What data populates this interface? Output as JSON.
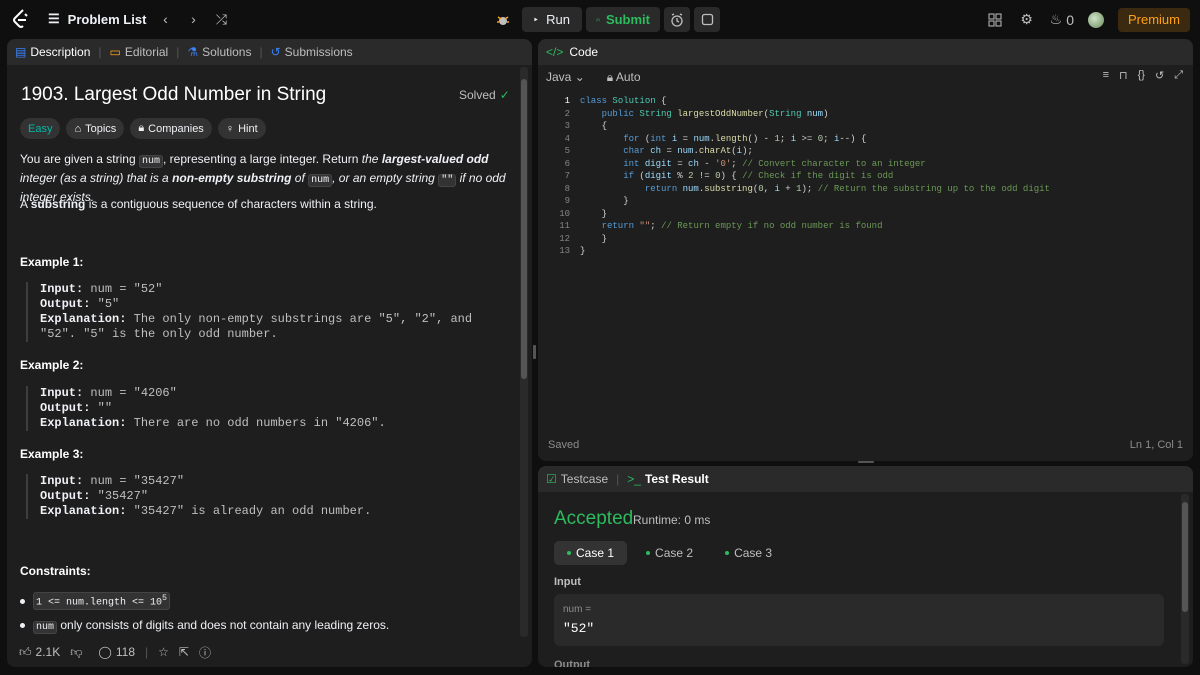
{
  "topbar": {
    "problem_list": "Problem List",
    "run": "Run",
    "submit": "Submit",
    "streak": "0",
    "premium": "Premium"
  },
  "left_tabs": [
    "Description",
    "Editorial",
    "Solutions",
    "Submissions"
  ],
  "problem": {
    "title": "1903. Largest Odd Number in String",
    "solved": "Solved",
    "chips": [
      "Easy",
      "Topics",
      "Companies",
      "Hint"
    ],
    "desc_1": "You are given a string",
    "desc_code_num": "num",
    "desc_2": ", representing a large integer. Return",
    "desc_3": "the",
    "desc_bold_1": "largest-valued odd",
    "desc_4": "integer (as a string) that is a",
    "desc_bold_2": "non-empty substring",
    "desc_5": "of",
    "desc_6": ", or an empty string",
    "desc_code_empty": "\"\"",
    "desc_7": "if no odd integer exists.",
    "sub_1": "A",
    "sub_bold": "substring",
    "sub_2": "is a contiguous sequence of characters within a string.",
    "examples": [
      {
        "title": "Example 1:",
        "input_label": "Input:",
        "input": "num = \"52\"",
        "output_label": "Output:",
        "output": "\"5\"",
        "expl_label": "Explanation:",
        "expl": "The only non-empty substrings are \"5\", \"2\", and \"52\". \"5\" is the only odd number."
      },
      {
        "title": "Example 2:",
        "input_label": "Input:",
        "input": "num = \"4206\"",
        "output_label": "Output:",
        "output": "\"\"",
        "expl_label": "Explanation:",
        "expl": "There are no odd numbers in \"4206\"."
      },
      {
        "title": "Example 3:",
        "input_label": "Input:",
        "input": "num = \"35427\"",
        "output_label": "Output:",
        "output": "\"35427\"",
        "expl_label": "Explanation:",
        "expl": "\"35427\" is already an odd number."
      }
    ],
    "constraints_title": "Constraints:",
    "constraint_1": "1 <= num.length <= 10",
    "constraint_1_sup": "5",
    "constraint_2_code": "num",
    "constraint_2": "only consists of digits and does not contain any leading zeros."
  },
  "footer": {
    "likes": "2.1K",
    "comments": "118"
  },
  "code_panel": {
    "title": "Code",
    "language": "Java",
    "mode": "Auto",
    "line_numbers": [
      "1",
      "2",
      "3",
      "4",
      "5",
      "6",
      "7",
      "8",
      "9",
      "10",
      "11",
      "12",
      "13"
    ],
    "saved": "Saved",
    "cursor": "Ln 1, Col 1"
  },
  "result_panel": {
    "tab_testcase": "Testcase",
    "tab_result": "Test Result",
    "status": "Accepted",
    "runtime": "Runtime: 0 ms",
    "cases": [
      "Case 1",
      "Case 2",
      "Case 3"
    ],
    "input_label": "Input",
    "var_name": "num =",
    "var_value": "\"52\"",
    "output_label": "Output"
  },
  "colors": {
    "accent": "#ffa116",
    "success": "#2cbb5d",
    "easy": "#00b8a3"
  }
}
